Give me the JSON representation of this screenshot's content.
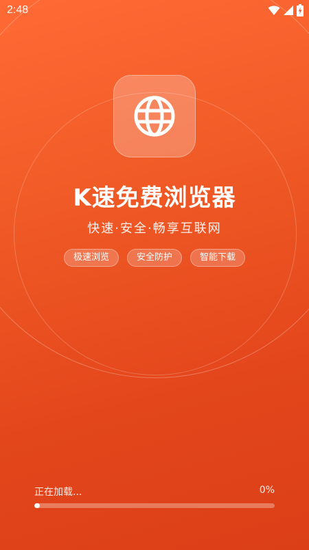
{
  "status_bar": {
    "time": "2:48",
    "icons": [
      "wifi-icon",
      "signal-icon",
      "battery-charging-icon"
    ]
  },
  "app": {
    "icon": "globe-icon",
    "title": "K速免费浏览器",
    "tagline": "快速·安全·畅享互联网"
  },
  "features": [
    {
      "label": "极速浏览"
    },
    {
      "label": "安全防护"
    },
    {
      "label": "智能下载"
    }
  ],
  "loading": {
    "label": "正在加载...",
    "percent_text": "0%",
    "progress": 0
  },
  "colors": {
    "background_top": "#ff6a35",
    "background_bottom": "#dc3f17",
    "foreground": "#ffffff"
  }
}
